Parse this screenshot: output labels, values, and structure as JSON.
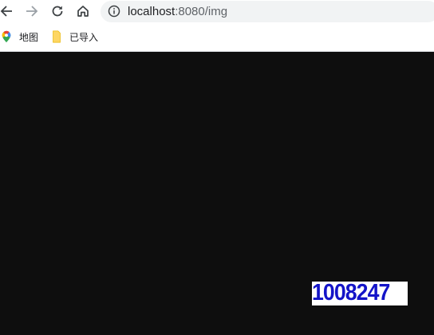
{
  "browser": {
    "url_host": "localhost",
    "url_path": ":8080/img"
  },
  "bookmarks": [
    {
      "label": "地图",
      "icon": "maps-pin-icon"
    },
    {
      "label": "已导入",
      "icon": "folder-icon"
    }
  ],
  "captcha": {
    "text": "1008247",
    "text_color": "#1414c8",
    "background": "#ffffff"
  },
  "colors": {
    "page_background": "#0e0e0e",
    "toolbar_background": "#ffffff",
    "omnibox_background": "#f1f3f4"
  }
}
